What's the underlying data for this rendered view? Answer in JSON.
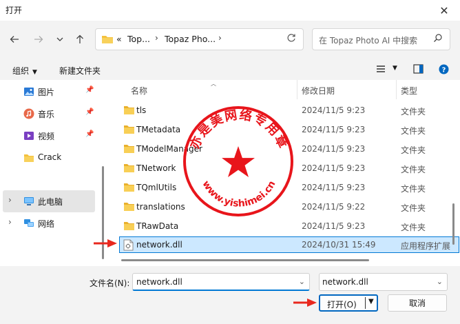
{
  "window": {
    "title": "打开",
    "close_glyph": "✕"
  },
  "nav": {
    "back_icon": "arrow-left-icon",
    "forward_icon": "arrow-right-icon",
    "recent_icon": "chevron-down-icon",
    "up_icon": "arrow-up-icon"
  },
  "address": {
    "overflow": "«",
    "segments": [
      "Top...",
      "Topaz Pho..."
    ],
    "chevron": "›"
  },
  "search": {
    "placeholder": "在 Topaz Photo AI 中搜索"
  },
  "commands": {
    "organize": "组织",
    "new_folder": "新建文件夹"
  },
  "sidebar": {
    "items": [
      {
        "label": "图片",
        "icon": "pictures-icon",
        "pinned": true
      },
      {
        "label": "音乐",
        "icon": "music-icon",
        "pinned": true
      },
      {
        "label": "视频",
        "icon": "video-icon",
        "pinned": true
      },
      {
        "label": "Crack",
        "icon": "folder-icon",
        "pinned": false
      },
      {
        "label": "此电脑",
        "icon": "computer-icon",
        "pinned": false,
        "expandable": true,
        "selected": true
      },
      {
        "label": "网络",
        "icon": "network-icon",
        "pinned": false,
        "expandable": true
      }
    ]
  },
  "columns": {
    "name": "名称",
    "date": "修改日期",
    "type": "类型"
  },
  "files": [
    {
      "name": "tls",
      "date": "2024/11/5 9:23",
      "type": "文件夹",
      "kind": "folder"
    },
    {
      "name": "TMetadata",
      "date": "2024/11/5 9:23",
      "type": "文件夹",
      "kind": "folder"
    },
    {
      "name": "TModelManager",
      "date": "2024/11/5 9:23",
      "type": "文件夹",
      "kind": "folder"
    },
    {
      "name": "TNetwork",
      "date": "2024/11/5 9:23",
      "type": "文件夹",
      "kind": "folder"
    },
    {
      "name": "TQmlUtils",
      "date": "2024/11/5 9:23",
      "type": "文件夹",
      "kind": "folder"
    },
    {
      "name": "translations",
      "date": "2024/11/5 9:22",
      "type": "文件夹",
      "kind": "folder"
    },
    {
      "name": "TRawData",
      "date": "2024/11/5 9:23",
      "type": "文件夹",
      "kind": "folder"
    },
    {
      "name": "network.dll",
      "date": "2024/10/31 15:49",
      "type": "应用程序扩展",
      "kind": "dll",
      "selected": true
    }
  ],
  "footer": {
    "filename_label": "文件名(N):",
    "filename_value": "network.dll",
    "filetype_value": "network.dll",
    "open_label": "打开(O)",
    "cancel_label": "取消"
  },
  "stamp": {
    "text": "亦是美网络专用章",
    "url": "www.yishimei.cn"
  },
  "colors": {
    "accent": "#0078d4",
    "selection": "#cce8ff",
    "folder": "#f4c13d",
    "stamp_red": "#e8151b",
    "annotation_red": "#e8281e"
  }
}
